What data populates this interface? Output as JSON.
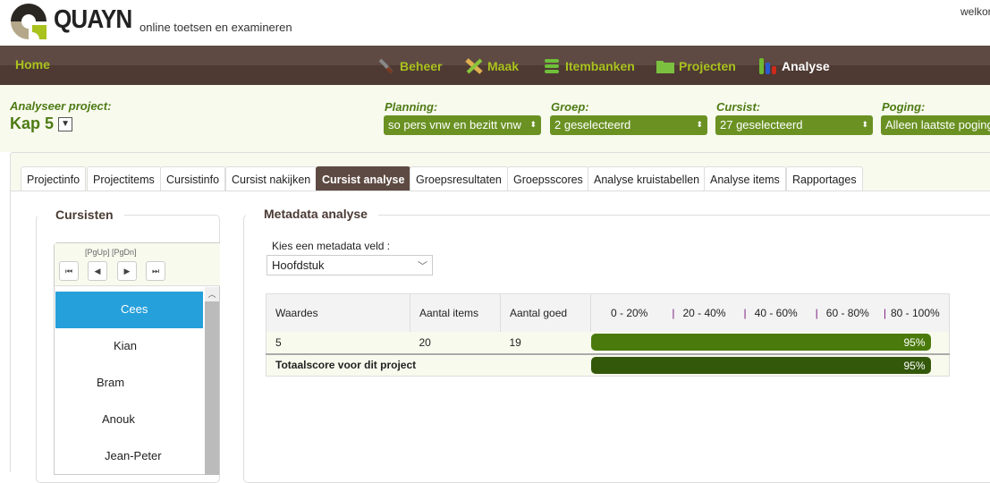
{
  "header": {
    "brand": "QUAYN",
    "tagline": "online toetsen en examineren",
    "welcome": "welkom"
  },
  "nav": {
    "home": "Home",
    "items": [
      {
        "label": "Beheer",
        "icon": "wrench-icon"
      },
      {
        "label": "Maak",
        "icon": "pencil-ruler-icon"
      },
      {
        "label": "Itembanken",
        "icon": "database-icon"
      },
      {
        "label": "Projecten",
        "icon": "folder-icon"
      },
      {
        "label": "Analyse",
        "icon": "bar-chart-icon",
        "active": true
      }
    ]
  },
  "filters": {
    "project_label": "Analyseer project:",
    "project": "Kap 5",
    "planning": {
      "label": "Planning:",
      "value": "so pers vnw en bezitt vnw"
    },
    "groep": {
      "label": "Groep:",
      "value": "2 geselecteerd"
    },
    "cursist": {
      "label": "Cursist:",
      "value": "27 geselecteerd"
    },
    "poging": {
      "label": "Poging:",
      "value": "Alleen laatste poging"
    }
  },
  "tabs": [
    "Projectinfo",
    "Projectitems",
    "Cursistinfo",
    "Cursist nakijken",
    "Cursist analyse",
    "Groepsresultaten",
    "Groepsscores",
    "Analyse kruistabellen",
    "Analyse items",
    "Rapportages"
  ],
  "active_tab": "Cursist analyse",
  "cursisten": {
    "title": "Cursisten",
    "pager_hint": "[PgUp] [PgDn]",
    "students": [
      "Cees",
      "Kian",
      "Bram",
      "Anouk",
      "Jean-Peter"
    ],
    "selected": "Cees"
  },
  "metadata": {
    "title": "Metadata analyse",
    "field_label": "Kies een metadata veld :",
    "field_value": "Hoofdstuk",
    "columns": [
      "Waardes",
      "Aantal items",
      "Aantal goed"
    ],
    "ranges": [
      "0 - 20%",
      "20 - 40%",
      "40 - 60%",
      "60 - 80%",
      "80 - 100%"
    ],
    "rows": [
      {
        "waarde": "5",
        "items": "20",
        "goed": "19",
        "percent": 95,
        "percent_label": "95%"
      }
    ],
    "total": {
      "label": "Totaalscore voor dit project",
      "percent": 95,
      "percent_label": "95%"
    },
    "colors": {
      "row_bar": "#4a7a0c",
      "total_bar": "#33580a"
    }
  }
}
